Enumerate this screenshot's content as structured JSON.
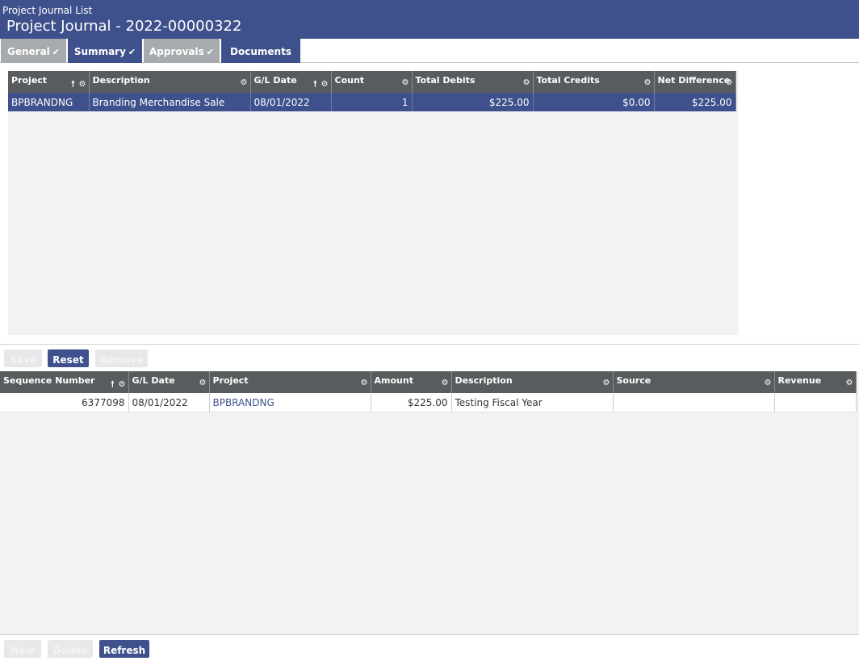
{
  "header": {
    "breadcrumb": "Project Journal List",
    "title": "Project Journal - 2022-00000322"
  },
  "tabs": [
    {
      "label": "General",
      "checked": true
    },
    {
      "label": "Summary",
      "checked": true
    },
    {
      "label": "Approvals",
      "checked": true
    },
    {
      "label": "Documents",
      "checked": false
    }
  ],
  "icons": {
    "check": "✔",
    "sort": "🠕",
    "gear": "⚙"
  },
  "summary_grid": {
    "columns": [
      "Project",
      "Description",
      "G/L Date",
      "Count",
      "Total Debits",
      "Total Credits",
      "Net Difference"
    ],
    "rows": [
      {
        "project": "BPBRANDNG",
        "description": "Branding Merchandise Sale",
        "gl_date": "08/01/2022",
        "count": "1",
        "total_debits": "$225.00",
        "total_credits": "$0.00",
        "net_difference": "$225.00"
      }
    ]
  },
  "actions": {
    "save": "Save",
    "reset": "Reset",
    "remove": "Remove"
  },
  "detail_grid": {
    "columns": [
      "Sequence Number",
      "G/L Date",
      "Project",
      "Amount",
      "Description",
      "Source",
      "Revenue"
    ],
    "rows": [
      {
        "sequence_number": "6377098",
        "gl_date": "08/01/2022",
        "project": "BPBRANDNG",
        "amount": "$225.00",
        "description": "Testing Fiscal Year",
        "source": "",
        "revenue": ""
      }
    ]
  },
  "bottom_actions": {
    "new": "New",
    "delete": "Delete",
    "refresh": "Refresh"
  },
  "colors": {
    "brand": "#3f518c",
    "header_grey": "#595c5e",
    "tab_grey": "#a8abae"
  }
}
